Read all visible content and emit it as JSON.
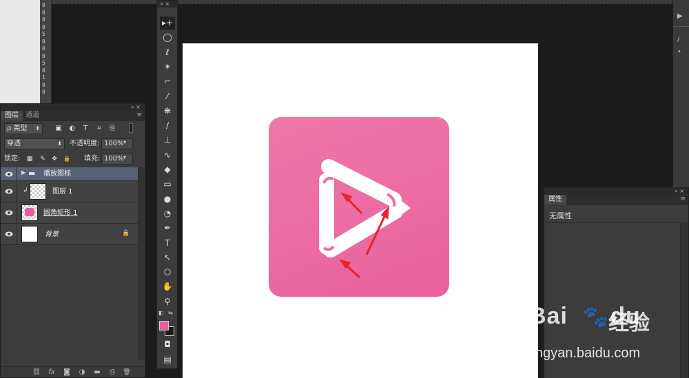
{
  "rulers": {
    "vertical_ticks": [
      "0",
      "0",
      "0",
      "0",
      "5",
      "0",
      "0",
      "0",
      "5",
      "0",
      "1",
      "0",
      "0"
    ]
  },
  "tools_panel": {
    "collapse": "»",
    "close": "×",
    "tools": [
      {
        "name": "move-tool",
        "glyph": "▸+"
      },
      {
        "name": "marquee-tool",
        "glyph": "◯"
      },
      {
        "name": "lasso-tool",
        "glyph": "ℓ"
      },
      {
        "name": "magic-wand-tool",
        "glyph": "✶"
      },
      {
        "name": "crop-tool",
        "glyph": "⌐"
      },
      {
        "name": "eyedropper-tool",
        "glyph": "⁄"
      },
      {
        "name": "healing-brush-tool",
        "glyph": "❋"
      },
      {
        "name": "brush-tool",
        "glyph": "∕"
      },
      {
        "name": "clone-stamp-tool",
        "glyph": "⊥"
      },
      {
        "name": "history-brush-tool",
        "glyph": "∿"
      },
      {
        "name": "eraser-tool",
        "glyph": "◆"
      },
      {
        "name": "gradient-tool",
        "glyph": "▭"
      },
      {
        "name": "blur-tool",
        "glyph": "●"
      },
      {
        "name": "dodge-tool",
        "glyph": "◔"
      },
      {
        "name": "pen-tool",
        "glyph": "✒"
      },
      {
        "name": "type-tool",
        "glyph": "T"
      },
      {
        "name": "path-selection-tool",
        "glyph": "↖"
      },
      {
        "name": "shape-tool",
        "glyph": "⬡"
      },
      {
        "name": "hand-tool",
        "glyph": "✋"
      },
      {
        "name": "zoom-tool",
        "glyph": "⚲"
      }
    ],
    "foreground_color": "#e3609c",
    "background_color": "#1a1a1a",
    "quickmask_glyph": "◘",
    "screenmode_glyph": "▤"
  },
  "layers_panel": {
    "collapse": "»",
    "close": "×",
    "tabs": [
      "图层",
      "通道"
    ],
    "menu_glyph": "≡",
    "filter_kind": "ρ 类型",
    "filter_icons": [
      "▣",
      "◐",
      "T",
      "⌗",
      "⎘"
    ],
    "blend_mode": "穿透",
    "opacity_label": "不透明度:",
    "opacity_value": "100%",
    "lock_label": "锁定:",
    "lock_icons": [
      "▦",
      "✎",
      "✥",
      "🔒"
    ],
    "fill_label": "填充:",
    "fill_value": "100%",
    "layers": [
      {
        "name": "播放图标",
        "type": "group",
        "selected": true
      },
      {
        "name": "图层 1",
        "type": "raster",
        "clipped": true
      },
      {
        "name": "圆角矩形 1",
        "type": "shape"
      },
      {
        "name": "背景",
        "type": "background",
        "locked": true
      }
    ],
    "bottom_icons": [
      "⛓",
      "fx",
      "◙",
      "◑",
      "▬",
      "⎙",
      "🗑"
    ]
  },
  "properties_panel": {
    "collapse": "»",
    "close": "×",
    "tab": "属性",
    "menu_glyph": "≡",
    "message": "无属性"
  },
  "artwork": {
    "icon_color_top": "#ee78a8",
    "icon_color_bottom": "#e9619d",
    "arrow_color": "#e8242b"
  },
  "watermark": {
    "brand": "Bai",
    "brand_suffix": "du",
    "cn": "经验",
    "url": "jingyan.baidu.com"
  }
}
